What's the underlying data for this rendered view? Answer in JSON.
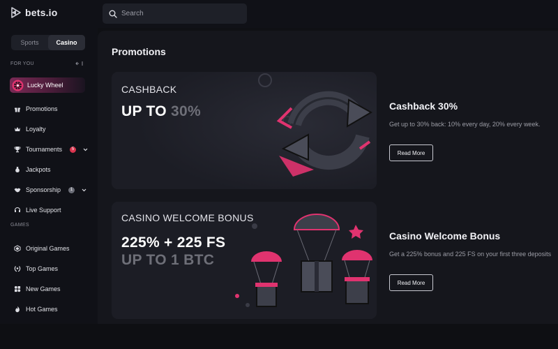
{
  "app": {
    "logo_text": "bets.io"
  },
  "search": {
    "placeholder": "Search"
  },
  "sidebar": {
    "toggle": {
      "sports": "Sports",
      "casino": "Casino"
    },
    "for_you_label": "FOR YOU",
    "lucky_wheel": "Lucky Wheel",
    "items": [
      {
        "label": "Promotions"
      },
      {
        "label": "Loyalty"
      },
      {
        "label": "Tournaments",
        "badge": "5"
      },
      {
        "label": "Jackpots"
      },
      {
        "label": "Sponsorship",
        "badge": "1"
      },
      {
        "label": "Live Support"
      }
    ],
    "games_label": "GAMES",
    "games": [
      {
        "label": "Original Games"
      },
      {
        "label": "Top Games"
      },
      {
        "label": "New Games"
      },
      {
        "label": "Hot Games"
      }
    ]
  },
  "main": {
    "title": "Promotions",
    "promos": [
      {
        "banner_small": "CASHBACK",
        "banner_big_light": "UP TO ",
        "banner_big_dim": "30%",
        "title": "Cashback 30%",
        "description": "Get up to 30% back: 10% every day, 20% every week.",
        "button": "Read More"
      },
      {
        "banner_small": "CASINO WELCOME BONUS",
        "banner_big_light": "225% + 225 FS",
        "banner_big_dim": "UP TO 1 BTC",
        "title": "Casino Welcome Bonus",
        "description": "Get a 225% bonus and 225 FS on your first three deposits",
        "button": "Read More"
      }
    ]
  },
  "colors": {
    "accent": "#e0336f",
    "badge": "#d9344e",
    "badge_grey": "#6c6e78"
  }
}
